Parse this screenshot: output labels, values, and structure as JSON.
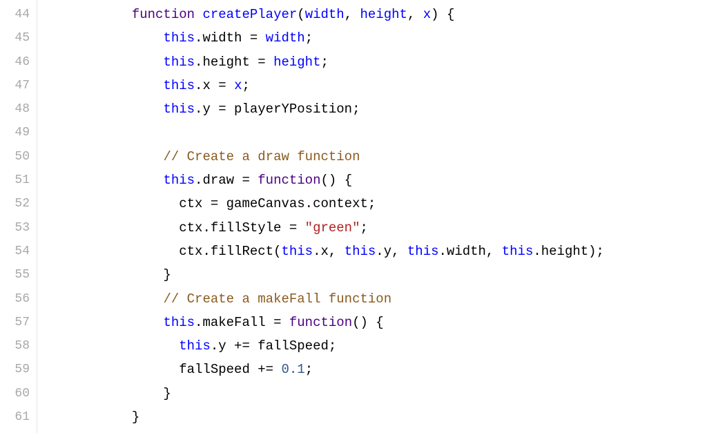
{
  "startLine": 44,
  "lines": [
    {
      "num": 44,
      "tokens": [
        {
          "t": "            ",
          "c": "punc"
        },
        {
          "t": "function",
          "c": "kw"
        },
        {
          "t": " ",
          "c": "punc"
        },
        {
          "t": "createPlayer",
          "c": "fn"
        },
        {
          "t": "(",
          "c": "punc"
        },
        {
          "t": "width",
          "c": "prm"
        },
        {
          "t": ", ",
          "c": "punc"
        },
        {
          "t": "height",
          "c": "prm"
        },
        {
          "t": ", ",
          "c": "punc"
        },
        {
          "t": "x",
          "c": "prm"
        },
        {
          "t": ") {",
          "c": "punc"
        }
      ]
    },
    {
      "num": 45,
      "tokens": [
        {
          "t": "                ",
          "c": "punc"
        },
        {
          "t": "this",
          "c": "this"
        },
        {
          "t": ".width = ",
          "c": "prop"
        },
        {
          "t": "width",
          "c": "prm"
        },
        {
          "t": ";",
          "c": "punc"
        }
      ]
    },
    {
      "num": 46,
      "tokens": [
        {
          "t": "                ",
          "c": "punc"
        },
        {
          "t": "this",
          "c": "this"
        },
        {
          "t": ".height = ",
          "c": "prop"
        },
        {
          "t": "height",
          "c": "prm"
        },
        {
          "t": ";",
          "c": "punc"
        }
      ]
    },
    {
      "num": 47,
      "tokens": [
        {
          "t": "                ",
          "c": "punc"
        },
        {
          "t": "this",
          "c": "this"
        },
        {
          "t": ".x = ",
          "c": "prop"
        },
        {
          "t": "x",
          "c": "prm"
        },
        {
          "t": ";",
          "c": "punc"
        }
      ]
    },
    {
      "num": 48,
      "tokens": [
        {
          "t": "                ",
          "c": "punc"
        },
        {
          "t": "this",
          "c": "this"
        },
        {
          "t": ".y = playerYPosition;",
          "c": "prop"
        }
      ]
    },
    {
      "num": 49,
      "tokens": [
        {
          "t": "",
          "c": "punc"
        }
      ]
    },
    {
      "num": 50,
      "tokens": [
        {
          "t": "                ",
          "c": "punc"
        },
        {
          "t": "// Create a draw function",
          "c": "cmt"
        }
      ]
    },
    {
      "num": 51,
      "tokens": [
        {
          "t": "                ",
          "c": "punc"
        },
        {
          "t": "this",
          "c": "this"
        },
        {
          "t": ".draw = ",
          "c": "prop"
        },
        {
          "t": "function",
          "c": "kw"
        },
        {
          "t": "() {",
          "c": "punc"
        }
      ]
    },
    {
      "num": 52,
      "tokens": [
        {
          "t": "                  ctx = gameCanvas.context;",
          "c": "prop"
        }
      ]
    },
    {
      "num": 53,
      "tokens": [
        {
          "t": "                  ctx.fillStyle = ",
          "c": "prop"
        },
        {
          "t": "\"green\"",
          "c": "str"
        },
        {
          "t": ";",
          "c": "punc"
        }
      ]
    },
    {
      "num": 54,
      "tokens": [
        {
          "t": "                  ctx.fillRect(",
          "c": "prop"
        },
        {
          "t": "this",
          "c": "this"
        },
        {
          "t": ".x, ",
          "c": "prop"
        },
        {
          "t": "this",
          "c": "this"
        },
        {
          "t": ".y, ",
          "c": "prop"
        },
        {
          "t": "this",
          "c": "this"
        },
        {
          "t": ".width, ",
          "c": "prop"
        },
        {
          "t": "this",
          "c": "this"
        },
        {
          "t": ".height);",
          "c": "prop"
        }
      ]
    },
    {
      "num": 55,
      "tokens": [
        {
          "t": "                }",
          "c": "punc"
        }
      ]
    },
    {
      "num": 56,
      "tokens": [
        {
          "t": "                ",
          "c": "punc"
        },
        {
          "t": "// Create a makeFall function",
          "c": "cmt"
        }
      ]
    },
    {
      "num": 57,
      "tokens": [
        {
          "t": "                ",
          "c": "punc"
        },
        {
          "t": "this",
          "c": "this"
        },
        {
          "t": ".makeFall = ",
          "c": "prop"
        },
        {
          "t": "function",
          "c": "kw"
        },
        {
          "t": "() {",
          "c": "punc"
        }
      ]
    },
    {
      "num": 58,
      "tokens": [
        {
          "t": "                  ",
          "c": "punc"
        },
        {
          "t": "this",
          "c": "this"
        },
        {
          "t": ".y += fallSpeed;",
          "c": "prop"
        }
      ]
    },
    {
      "num": 59,
      "tokens": [
        {
          "t": "                  fallSpeed += ",
          "c": "prop"
        },
        {
          "t": "0.1",
          "c": "num"
        },
        {
          "t": ";",
          "c": "punc"
        }
      ]
    },
    {
      "num": 60,
      "tokens": [
        {
          "t": "                }",
          "c": "punc"
        }
      ]
    },
    {
      "num": 61,
      "tokens": [
        {
          "t": "            }",
          "c": "punc"
        }
      ]
    }
  ]
}
